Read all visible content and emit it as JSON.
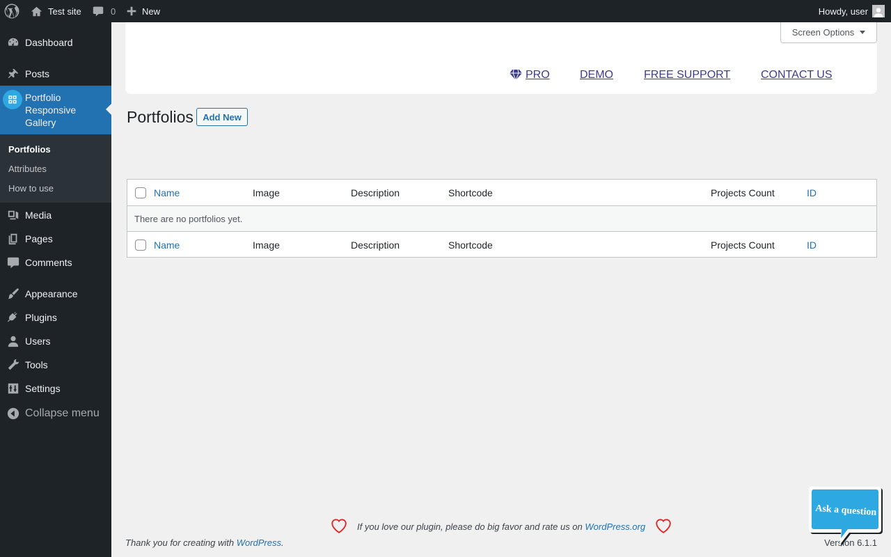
{
  "admin_bar": {
    "site_name": "Test site",
    "comments_count": "0",
    "new_label": "New",
    "greeting": "Howdy, user"
  },
  "sidebar": {
    "items": [
      {
        "label": "Dashboard",
        "icon": "dashboard-icon"
      },
      {
        "label": "Posts",
        "icon": "pin-icon"
      },
      {
        "label": "Portfolio Responsive Gallery",
        "icon": "grid-icon"
      },
      {
        "label": "Media",
        "icon": "media-icon"
      },
      {
        "label": "Pages",
        "icon": "pages-icon"
      },
      {
        "label": "Comments",
        "icon": "comment-icon"
      },
      {
        "label": "Appearance",
        "icon": "brush-icon"
      },
      {
        "label": "Plugins",
        "icon": "plug-icon"
      },
      {
        "label": "Users",
        "icon": "user-icon"
      },
      {
        "label": "Tools",
        "icon": "wrench-icon"
      },
      {
        "label": "Settings",
        "icon": "settings-icon"
      }
    ],
    "submenu": [
      "Portfolios",
      "Attributes",
      "How to use"
    ],
    "collapse_label": "Collapse menu"
  },
  "header": {
    "screen_options": "Screen Options",
    "links": [
      "PRO",
      "DEMO",
      "FREE SUPPORT",
      "CONTACT US"
    ]
  },
  "page": {
    "title": "Portfolios",
    "add_new": "Add New"
  },
  "table": {
    "columns": [
      "Name",
      "Image",
      "Description",
      "Shortcode",
      "Projects Count",
      "ID"
    ],
    "empty_message": "There are no portfolios yet."
  },
  "footer": {
    "rate_text": "If you love our plugin, please do big favor and rate us on",
    "rate_link": "WordPress.org",
    "thanks_text": "Thank you for creating with",
    "thanks_link": "WordPress",
    "version": "Version 6.1.1",
    "ask_question": "Ask a question"
  },
  "colors": {
    "adminbar_bg": "#1d2327",
    "accent": "#2271b1",
    "plugin_icon": "#2ea8e0",
    "heart": "#e02a2a"
  }
}
